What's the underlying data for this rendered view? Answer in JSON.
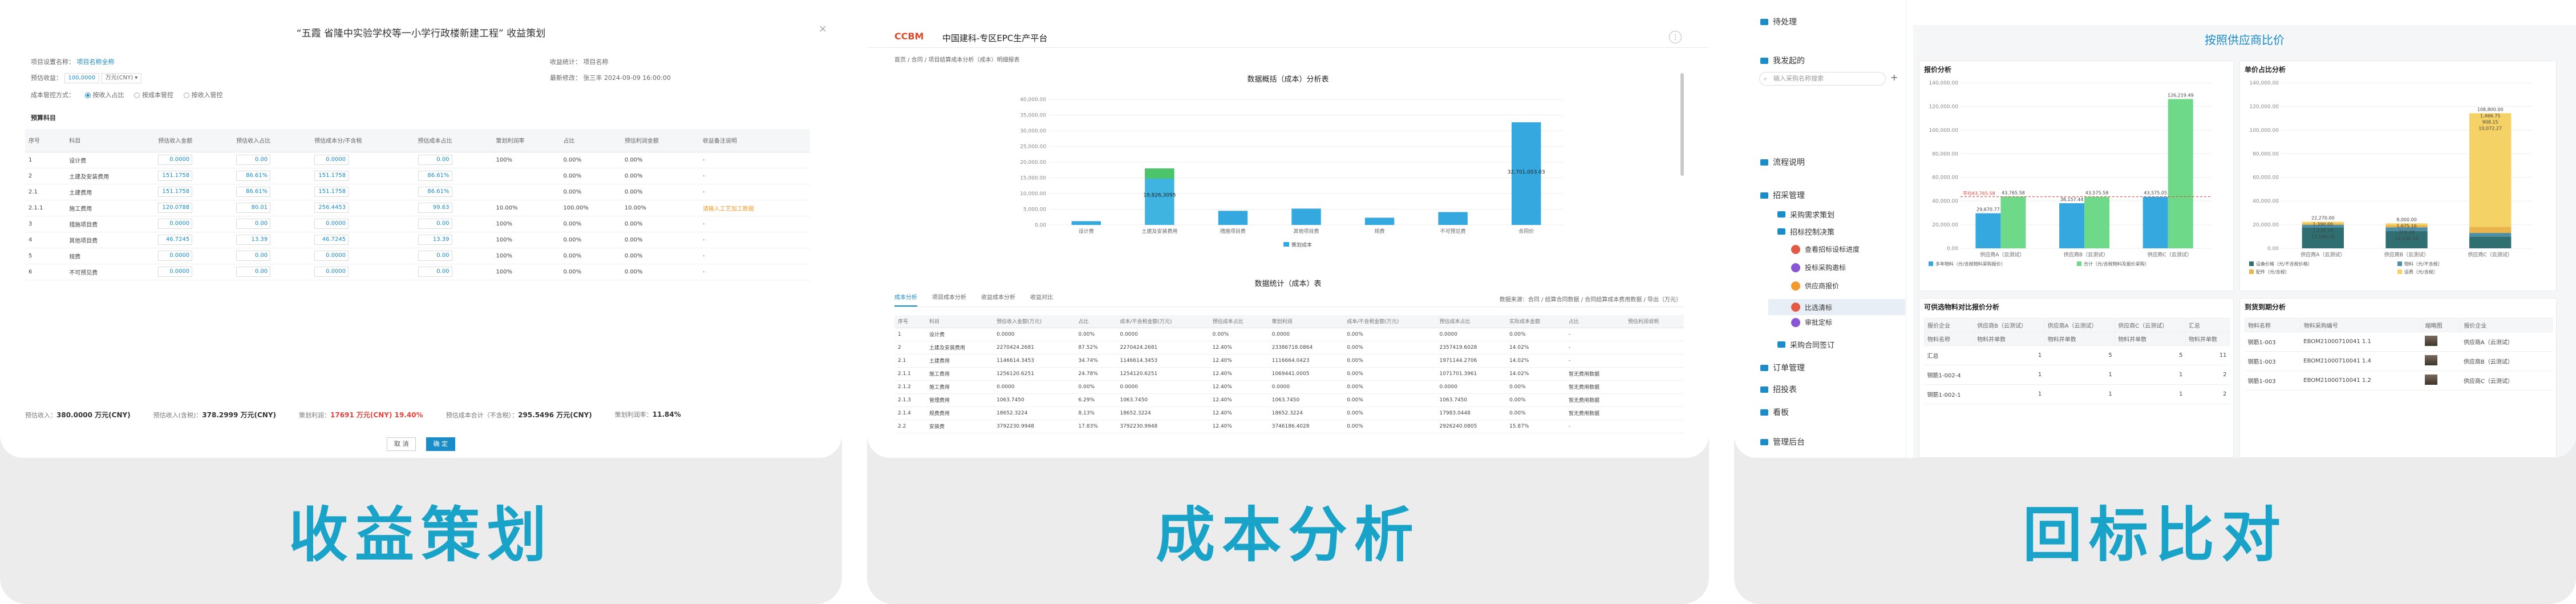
{
  "panels": [
    {
      "caption": "收益策划",
      "modal": {
        "title": "“五霞 省隆中实验学校等一小学行政楼新建工程” 收益策划",
        "fields": [
          {
            "label": "项目设置名称",
            "value": "项目名称全称"
          },
          {
            "label": "预估收益",
            "value": "100,0000"
          },
          {
            "label": "收益统计",
            "value": "项目名称"
          },
          {
            "label": "最新修改",
            "value": "张三丰 2024-09-09 16:00:00"
          },
          {
            "label": "成本管控方式",
            "value": ""
          }
        ],
        "radios": [
          "按收入占比",
          "按成本管控",
          "按收入管控"
        ],
        "section": "预算科目",
        "table_headers": [
          "序号",
          "科目",
          "预估收入金额",
          "预估收入占比",
          "预估成本分/不含税",
          "预估成本占比",
          "策划利润率",
          "占比",
          "预估利润金额",
          "收益备注说明"
        ],
        "rows": [
          {
            "no": "1",
            "name": "设计费",
            "v1": "0.0000",
            "v2": "0.00",
            "v3": "0.0000",
            "v4": "0.00",
            "v5": "100%",
            "v6": "0.00%",
            "v7": "0.00%",
            "note": "-"
          },
          {
            "no": "2",
            "name": "土建及安装费用",
            "v1": "151.1758",
            "v2": "86.61%",
            "v3": "151.1758",
            "v4": "86.61%",
            "v5": "",
            "v6": "0.00%",
            "v7": "0.00%",
            "note": "-"
          },
          {
            "no": "2.1",
            "name": "土建费用",
            "v1": "151.1758",
            "v2": "86.61%",
            "v3": "151.1758",
            "v4": "86.61%",
            "v5": "",
            "v6": "0.00%",
            "v7": "0.00%",
            "note": "-"
          },
          {
            "no": "2.1.1",
            "name": "施工费用",
            "v1": "120.0788",
            "v2": "80.01",
            "v3": "256.4453",
            "v4": "99.63",
            "v5": "10.00%",
            "v6": "100.00%",
            "v7": "10.00%",
            "note": "请输入工艺加工数据"
          },
          {
            "no": "3",
            "name": "措施项目费",
            "v1": "0.0000",
            "v2": "0.00",
            "v3": "0.0000",
            "v4": "0.00",
            "v5": "100%",
            "v6": "0.00%",
            "v7": "0.00%",
            "note": "-"
          },
          {
            "no": "4",
            "name": "其他项目费",
            "v1": "46.7245",
            "v2": "13.39",
            "v3": "46.7245",
            "v4": "13.39",
            "v5": "100%",
            "v6": "0.00%",
            "v7": "0.00%",
            "note": "-"
          },
          {
            "no": "5",
            "name": "规费",
            "v1": "0.0000",
            "v2": "0.00",
            "v3": "0.0000",
            "v4": "0.00",
            "v5": "100%",
            "v6": "0.00%",
            "v7": "0.00%",
            "note": "-"
          },
          {
            "no": "6",
            "name": "不可预见费",
            "v1": "0.0000",
            "v2": "0.00",
            "v3": "0.0000",
            "v4": "0.00",
            "v5": "100%",
            "v6": "0.00%",
            "v7": "0.00%",
            "note": "-"
          }
        ],
        "summary": [
          {
            "label": "预估收入",
            "value": "380.0000 万元(CNY)",
            "red": false
          },
          {
            "label": "预估收入(含税)",
            "value": "378.2999 万元(CNY)",
            "red": false
          },
          {
            "label": "策划利润",
            "value": "17691 万元(CNY) 19.40%",
            "red": true
          },
          {
            "label": "预估成本合计（不含税）",
            "value": "295.5496 万元(CNY)",
            "red": false
          },
          {
            "label": "策划利润率",
            "value": "11.84%",
            "red": false
          }
        ],
        "buttons": {
          "cancel": "取 消",
          "confirm": "确 定"
        }
      }
    },
    {
      "caption": "成本分析",
      "header": {
        "logo_a": "CCBM",
        "logo_b": "",
        "title": "中国建科-专区EPC生产平台"
      },
      "breadcrumb": "首页 / 合同 / 项目结算成本分析（成本）明细报表",
      "chart_title": "数据概括（成本）分析表",
      "table_title": "数据统计（成本）表",
      "tabs": [
        "成本分析",
        "项目成本分析",
        "收益成本分析",
        "收益对比"
      ],
      "tab_tools": "数据来源：合同 / 结算合同数据 / 合同结算成本费用数据 / 导出（万元）",
      "chart_data": {
        "type": "bar",
        "categories": [
          "设计费",
          "土建及安装费用",
          "措施项目费",
          "其他项目费",
          "规费",
          "不可预见费",
          "合同价"
        ],
        "series": [
          {
            "name": "策划成本",
            "values": [
              1200,
              18000,
              4500,
              5200,
              2300,
              4100,
              32700
            ]
          }
        ],
        "ylim": [
          0,
          40000
        ],
        "yticks": [
          "0.00",
          "5,000.00",
          "10,000.00",
          "15,000.00",
          "20,000.00",
          "25,000.00",
          "30,000.00",
          "35,000.00",
          "40,000.00"
        ],
        "data_labels": [
          "",
          "19,826,3095",
          "",
          "",
          "",
          "",
          "32,701,003.03"
        ],
        "legend": "策划成本"
      },
      "table_headers": [
        "序号",
        "科目",
        "预估收入金额(万元)",
        "占比",
        "成本/不含税金额(万元)",
        "预估成本占比",
        "策划利润",
        "成本/不含税金额(万元)",
        "预估成本占比",
        "实际成本金额",
        "占比",
        "预估利润说明"
      ],
      "rows": [
        {
          "no": "1",
          "name": "设计费",
          "a": "0.0000",
          "b": "0.00%",
          "c": "0.0000",
          "d": "0.00%",
          "e": "0.0000",
          "f": "0.00%",
          "g": "0.0000",
          "h": "0.00%",
          "note": "-"
        },
        {
          "no": "2",
          "name": "土建及安装费用",
          "a": "2270424.2681",
          "b": "87.52%",
          "c": "2270424.2681",
          "d": "12.40%",
          "e": "23386718.0864",
          "f": "0.00%",
          "g": "2357419.6028",
          "h": "14.02%",
          "note": "-"
        },
        {
          "no": "2.1",
          "name": "土建费用",
          "a": "1146614.3453",
          "b": "34.74%",
          "c": "1146614.3453",
          "d": "12.40%",
          "e": "1116664.0423",
          "f": "0.00%",
          "g": "1971144.2706",
          "h": "14.02%",
          "note": "-"
        },
        {
          "no": "2.1.1",
          "name": "施工费用",
          "a": "1256120.6251",
          "b": "24.78%",
          "c": "1254120.6251",
          "d": "12.40%",
          "e": "1069441.0005",
          "f": "0.00%",
          "g": "1071701.3961",
          "h": "14.02%",
          "note": "暂无费用数据"
        },
        {
          "no": "2.1.2",
          "name": "施工费用",
          "a": "0.0000",
          "b": "0.00%",
          "c": "0.0000",
          "d": "12.40%",
          "e": "0.0000",
          "f": "0.00%",
          "g": "0.0000",
          "h": "0.00%",
          "note": "暂无费用数据"
        },
        {
          "no": "2.1.3",
          "name": "管理费用",
          "a": "1063.7450",
          "b": "6.29%",
          "c": "1063.7450",
          "d": "12.40%",
          "e": "1063.7450",
          "f": "0.00%",
          "g": "1063.7450",
          "h": "0.00%",
          "note": "暂无费用数据"
        },
        {
          "no": "2.1.4",
          "name": "规费费用",
          "a": "18652.3224",
          "b": "8.13%",
          "c": "18652.3224",
          "d": "12.40%",
          "e": "18652.3224",
          "f": "0.00%",
          "g": "17983.0448",
          "h": "0.00%",
          "note": "暂无费用数据"
        },
        {
          "no": "2.2",
          "name": "安装费",
          "a": "3792230.9948",
          "b": "17.83%",
          "c": "3792230.9948",
          "d": "12.40%",
          "e": "3746186.4028",
          "f": "0.00%",
          "g": "2926240.0805",
          "h": "15.87%",
          "note": "-"
        }
      ]
    },
    {
      "caption": "回标比对",
      "sidebar": {
        "items": [
          {
            "label": "待处理",
            "level": 0
          },
          {
            "label": "我发起的",
            "level": 0
          },
          {
            "label": "流程说明",
            "level": 0
          },
          {
            "label": "招采管理",
            "level": 0
          },
          {
            "label": "采购需求策划",
            "level": 1
          },
          {
            "label": "招标控制决策",
            "level": 1
          },
          {
            "label": "查看招标设标进度",
            "level": 2
          },
          {
            "label": "投标采购邀标",
            "level": 2
          },
          {
            "label": "供应商报价",
            "level": 2
          },
          {
            "label": "比选清标",
            "level": 2
          },
          {
            "label": "审批定标",
            "level": 2
          },
          {
            "label": "采购合同签订",
            "level": 1
          },
          {
            "label": "订单管理",
            "level": 0
          },
          {
            "label": "招投表",
            "level": 0
          },
          {
            "label": "看板",
            "level": 0
          },
          {
            "label": "管理后台",
            "level": 0
          }
        ],
        "search_placeholder": "输入采购名称搜索"
      },
      "main_title": "按照供应商比价",
      "chart_left": {
        "title": "报价分析",
        "chart_data": {
          "type": "bar",
          "categories": [
            "供应商A（云测试）",
            "供应商B（云测试）",
            "供应商C（云测试）"
          ],
          "series": [
            {
              "name": "多年物料（元/含税物料采购报价）",
              "values": [
                29670.77,
                38157.44,
                43575.05
              ]
            },
            {
              "name": "合计（元/含税物料及报价采购）",
              "values": [
                43765.58,
                43575.58,
                126219.49
              ]
            }
          ],
          "ylim": [
            0,
            140000
          ],
          "yticks": [
            "0.00",
            "20,000.00",
            "40,000.00",
            "60,000.00",
            "80,000.00",
            "100,000.00",
            "120,000.00",
            "140,000.00"
          ],
          "data_labels": [
            "29,670.77",
            "43,765.58",
            "38,157.44",
            "43,575.58",
            "43,575.05",
            "126,219.49"
          ],
          "reference_label": "平均43,765.58",
          "reference_value": 43765.58
        }
      },
      "chart_right": {
        "title": "单价占比分析",
        "chart_data": {
          "type": "bar",
          "categories": [
            "供应商A（云测试）",
            "供应商B（云测试）",
            "供应商C（云测试）"
          ],
          "series": [
            {
              "name": "设备价格（元/不含税价格）",
              "values": [
                17588,
                14630,
                10000
              ]
            },
            {
              "name": "物料（元/不含税）",
              "values": [
                2330,
                3130,
                3000
              ]
            },
            {
              "name": "配件（元/含税）",
              "values": [
                1136,
                1900,
                5240
              ]
            },
            {
              "name": "运费（元/含税）",
              "values": [
                1390,
                1450,
                96000
              ]
            }
          ],
          "ylim": [
            0,
            140000
          ],
          "yticks": [
            "0.00",
            "20,000.00",
            "40,000.00",
            "60,000.00",
            "80,000.00",
            "100,000.00",
            "120,000.00",
            "140,000.00"
          ],
          "data_labels": [
            "22,270.00",
            "1,390.00",
            "1,136.28",
            "17,588.78",
            "8,000.00",
            "1,675.16",
            "318.28",
            "14,030.58",
            "108,800.00",
            "1,466.75",
            "908.15",
            "10,072.27"
          ]
        }
      },
      "table_left": {
        "title": "可供选物料对比报价分析",
        "headers": [
          "报价企业",
          "供应商B（云测试）",
          "供应商A（云测试）",
          "供应商C（云测试）",
          "汇总"
        ],
        "subheaders": [
          "物料名称",
          "物料并单数",
          "物料并单数",
          "物料并单数",
          "物料并单数"
        ],
        "rows": [
          [
            "汇总",
            "1",
            "5",
            "5",
            "11"
          ],
          [
            "钢筋1-002-4",
            "1",
            "1",
            "1",
            "2"
          ],
          [
            "钢筋1-002-1",
            "1",
            "1",
            "1",
            "2"
          ]
        ]
      },
      "table_right": {
        "title": "到货到期分析",
        "headers": [
          "物料名称",
          "物料采购编号",
          "缩略图",
          "报价企业"
        ],
        "rows": [
          [
            "钢筋1-003",
            "EBOM21000710041 1.1",
            "供应商A（云测试）"
          ],
          [
            "钢筋1-003",
            "EBOM21000710041 1.4",
            "供应商B（云测试）"
          ],
          [
            "钢筋1-003",
            "EBOM21000710041 1.2",
            "供应商C（云测试）"
          ]
        ]
      }
    }
  ],
  "colors": {
    "accent": "#1aa3c8",
    "link": "#1a8cc9",
    "red": "#e5423c",
    "green": "#6fd98a",
    "blue": "#36a8e0",
    "darkteal": "#2f6f72",
    "yellow": "#f5d266"
  }
}
